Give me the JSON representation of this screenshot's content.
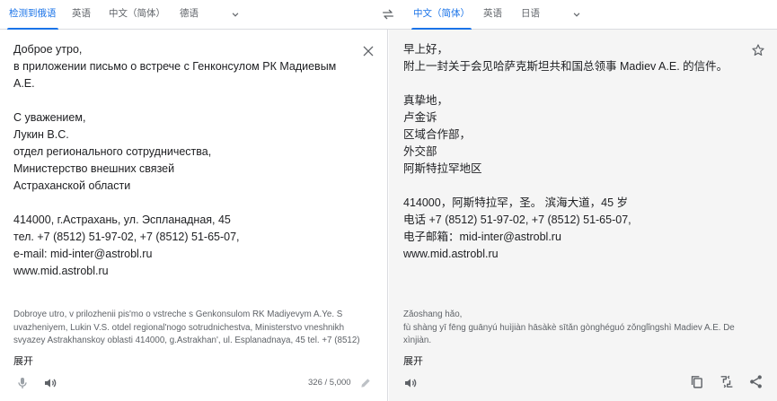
{
  "source_langs": {
    "detected": "检测到俄语",
    "tab2": "英语",
    "tab3": "中文（简体）",
    "tab4": "德语"
  },
  "target_langs": {
    "tab1": "中文（简体）",
    "tab2": "英语",
    "tab3": "日语"
  },
  "source": {
    "text": "Доброе утро,\nв приложении письмо о встрече с Генконсулом РК Мадиевым\nА.Е.\n\nС уважением,\nЛукин В.С.\nотдел регионального сотрудничества,\nМинистерство внешних связей\nАстраханской области\n\n414000, г.Астрахань, ул. Эспланадная, 45\nтел. +7 (8512) 51-97-02, +7 (8512) 51-65-07,\ne-mail: mid-inter@astrobl.ru\nwww.mid.astrobl.ru",
    "transliteration": "Dobroye utro, v prilozhenii pis'mo o vstreche s Genkonsulom RK Madiyevym A.Ye. S uvazheniyem, Lukin V.S. otdel regional'nogo sotrudnichestva, Ministerstvo vneshnikh svyazey Astrakhanskoy oblasti 414000, g.Astrakhan', ul. Esplanadnaya, 45 tel. +7 (8512)",
    "expand": "展开",
    "char_count": "326 / 5,000"
  },
  "target": {
    "text": "早上好，\n附上一封关于会见哈萨克斯坦共和国总领事 Madiev A.E. 的信件。\n\n真挚地，\n卢金诉\n区域合作部，\n外交部\n阿斯特拉罕地区\n\n414000，阿斯特拉罕，圣。 滨海大道，45 岁\n电话 +7 (8512) 51-97-02, +7 (8512) 51-65-07,\n电子邮箱：mid-inter@astrobl.ru\nwww.mid.astrobl.ru",
    "transliteration": "Zǎoshang hǎo,\nfù shàng yī fēng guānyú huìjiàn hāsàkè sītǎn gònghéguó zǒnglǐngshì Madiev A.E. De xìnjiàn.",
    "expand": "展开"
  },
  "colors": {
    "accent": "#1a73e8",
    "muted": "#5f6368",
    "target_bg": "#f5f5f5"
  }
}
